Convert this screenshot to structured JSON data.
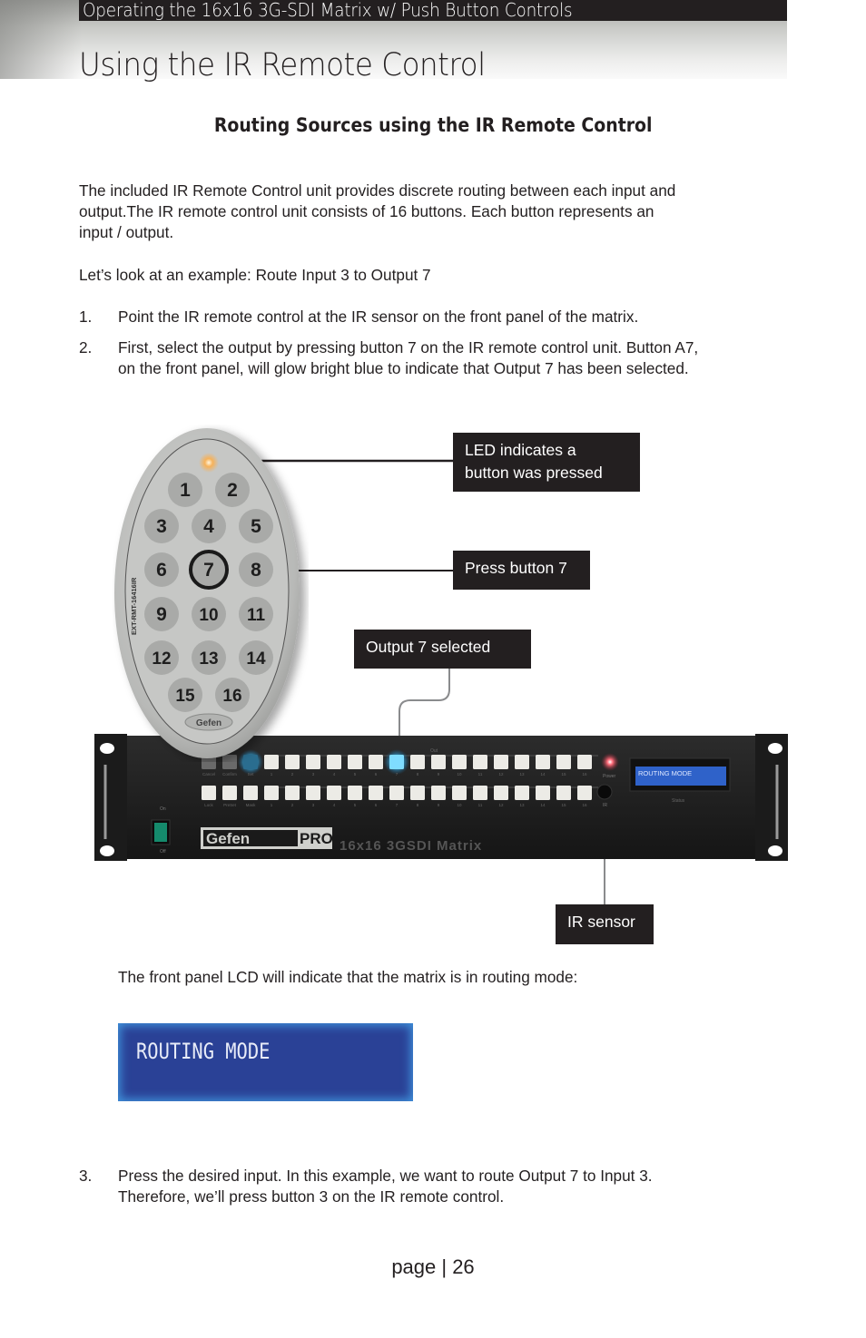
{
  "header": {
    "section_title": "Operating the 16x16 3G-SDI Matrix w/ Push Button Controls",
    "page_title": "Using the IR Remote Control"
  },
  "content": {
    "subtitle": "Routing Sources using the IR Remote Control",
    "intro_lines": [
      "The included IR Remote Control unit provides discrete routing between each input and",
      "output.The IR remote control unit consists of 16 buttons.  Each button represents an",
      "input / output."
    ],
    "example": "Let’s look at an example:  Route Input 3 to Output 7",
    "steps": [
      {
        "num": "1.",
        "lines": [
          "Point the IR remote control at the IR sensor on the front panel of the matrix."
        ]
      },
      {
        "num": "2.",
        "lines": [
          "First, select the output by pressing button 7 on the IR remote control unit.  Button A7,",
          "on the front panel,  will glow bright blue to indicate that Output 7 has been selected."
        ]
      },
      {
        "num": "3.",
        "lines": [
          "Press the desired input.  In this example, we want to route Output 7 to Input 3.",
          "Therefore, we’ll press button 3 on the IR remote control."
        ]
      }
    ],
    "lcd_note": "The front panel LCD will indicate that the matrix is in routing mode:",
    "lcd_display": "ROUTING MODE"
  },
  "figure": {
    "callouts": {
      "led": [
        "LED indicates a",
        "button was pressed"
      ],
      "press": "Press button 7",
      "output": "Output 7 selected",
      "ir": "IR sensor"
    },
    "remote": {
      "model": "EXT-RMT-16416IR",
      "brand": "Gefen",
      "buttons": [
        "1",
        "2",
        "3",
        "4",
        "5",
        "6",
        "7",
        "8",
        "9",
        "10",
        "11",
        "12",
        "13",
        "14",
        "15",
        "16"
      ],
      "highlighted_button": "7"
    },
    "device": {
      "brand_left": "Gefen",
      "brand_right": "PRO",
      "model": "16x16 3GSDI Matrix",
      "lcd_text": "ROUTING MODE",
      "top_row_labels": [
        "Cancel",
        "Confirm",
        "Set"
      ],
      "bottom_row_labels": [
        "Lock",
        "PreSet",
        "Mask"
      ],
      "out_label": "Out",
      "in_label": "In",
      "power_label": "Power",
      "ir_label": "IR",
      "status_label": "Status",
      "switch_on": "On",
      "switch_off": "Off",
      "selected_output": 7
    }
  },
  "footer": {
    "page": "page | 26"
  },
  "colors": {
    "dark": "#231f20",
    "lcd_blue": "#2a4196",
    "glow_blue": "#38b6f0",
    "led_orange": "#f6b25a"
  }
}
